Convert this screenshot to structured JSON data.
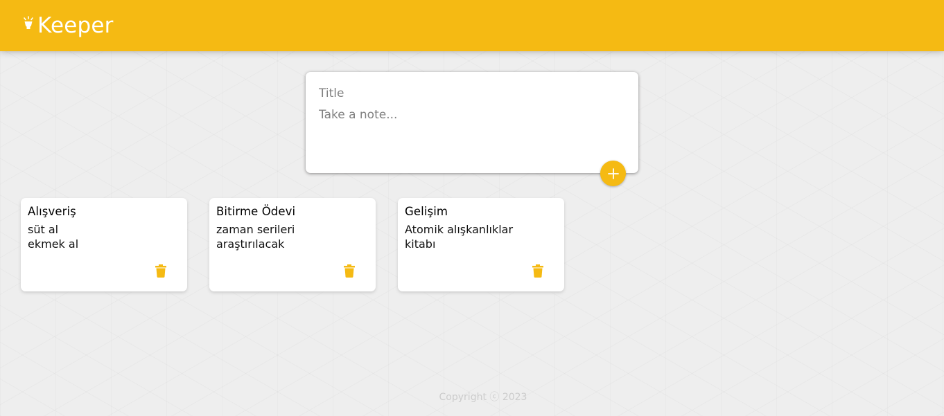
{
  "header": {
    "app_name": "Keeper",
    "brand_icon": "lightbulb-icon",
    "background_color": "#f5ba13"
  },
  "create_note": {
    "title_placeholder": "Title",
    "content_placeholder": "Take a note...",
    "add_icon": "plus-icon"
  },
  "notes": [
    {
      "title": "Alışveriş",
      "content": "süt al\nekmek al",
      "delete_icon": "trash-icon"
    },
    {
      "title": "Bitirme Ödevi",
      "content": "zaman serileri\naraştırılacak",
      "delete_icon": "trash-icon"
    },
    {
      "title": "Gelişim",
      "content": "Atomik alışkanlıklar\nkitabı",
      "delete_icon": "trash-icon"
    }
  ],
  "footer": {
    "copyright": "Copyright ⓒ 2023"
  },
  "colors": {
    "accent": "#f5ba13",
    "background": "#eeeeee",
    "card": "#ffffff",
    "footer_text": "#cccccc"
  }
}
